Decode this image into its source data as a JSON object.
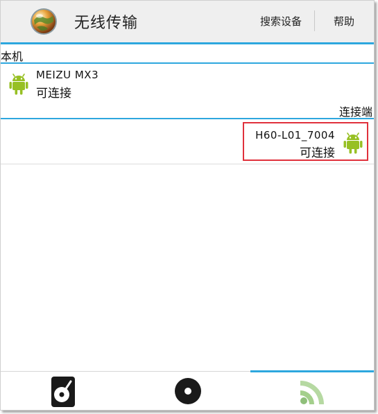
{
  "actionbar": {
    "title": "无线传输",
    "search_label": "搜索设备",
    "help_label": "帮助",
    "logo_icon": "globe-icon"
  },
  "local": {
    "header": "本机",
    "device": {
      "name": "MEIZU MX3",
      "status": "可连接",
      "icon": "android-icon"
    }
  },
  "remote": {
    "header": "连接端",
    "device": {
      "name": "H60-L01_7004",
      "status": "可连接",
      "icon": "android-icon",
      "highlighted": true
    }
  },
  "tabs": [
    {
      "icon": "phone-disc-icon",
      "active": false
    },
    {
      "icon": "disc-icon",
      "active": false
    },
    {
      "icon": "wifi-signal-icon",
      "active": true
    }
  ],
  "colors": {
    "accent": "#2da7de",
    "android_green": "#97c024",
    "highlight_border": "#e0303b",
    "actionbar_bg": "#efefef"
  }
}
